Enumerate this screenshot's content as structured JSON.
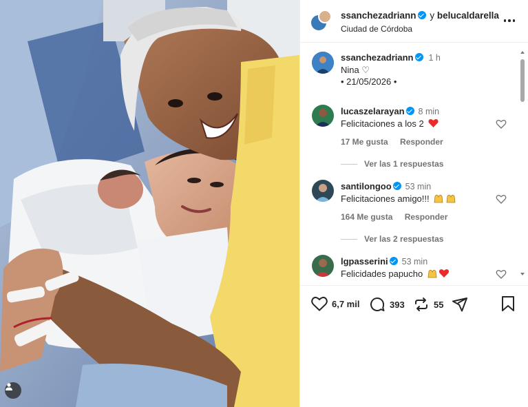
{
  "header": {
    "author": "ssanchezadriann",
    "connector": "y",
    "collaborator": "belucaldarella",
    "location": "Ciudad de Córdoba"
  },
  "caption": {
    "user": "ssanchezadriann",
    "time": "1 h",
    "text": "Nina ♡",
    "date": "• 21/05/2026 •"
  },
  "comments": [
    {
      "user": "lucaszelarayan",
      "time": "8 min",
      "text": "Felicitaciones a los 2",
      "emoji": "heart",
      "likes": "17 Me gusta",
      "reply": "Responder",
      "replies": "Ver las 1 respuestas"
    },
    {
      "user": "santilongoo",
      "time": "53 min",
      "text": "Felicitaciones amigo!!!",
      "emoji": "raising-hands x2",
      "likes": "164 Me gusta",
      "reply": "Responder",
      "replies": "Ver las 2 respuestas"
    },
    {
      "user": "lgpasserini",
      "time": "53 min",
      "text": "Felicidades papucho",
      "emoji": "raising-hands + heart"
    }
  ],
  "actions": {
    "likes": "6,7 mil",
    "comments": "393",
    "reposts": "55"
  },
  "colors": {
    "verified": "#0095f6",
    "heart_red": "#ed2a2a",
    "muted_text": "#737373",
    "photo_shirt": "#f3d86a"
  }
}
